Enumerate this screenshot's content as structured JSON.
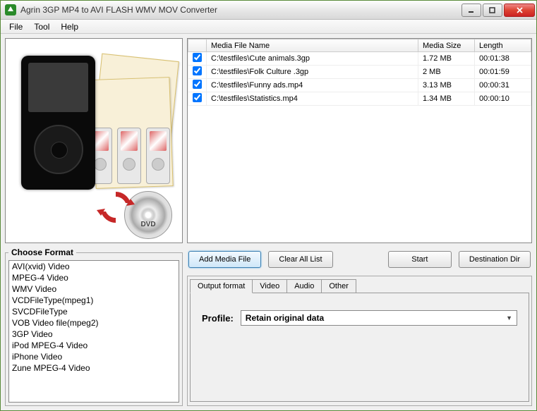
{
  "window": {
    "title": "Agrin 3GP MP4 to AVI FLASH WMV MOV Converter"
  },
  "menu": {
    "file": "File",
    "tool": "Tool",
    "help": "Help"
  },
  "table": {
    "col_name": "Media File Name",
    "col_size": "Media Size",
    "col_length": "Length",
    "rows": [
      {
        "name": "C:\\testfiles\\Cute animals.3gp",
        "size": "1.72 MB",
        "length": "00:01:38"
      },
      {
        "name": "C:\\testfiles\\Folk Culture .3gp",
        "size": "2 MB",
        "length": "00:01:59"
      },
      {
        "name": "C:\\testfiles\\Funny ads.mp4",
        "size": "3.13 MB",
        "length": "00:00:31"
      },
      {
        "name": "C:\\testfiles\\Statistics.mp4",
        "size": "1.34 MB",
        "length": "00:00:10"
      }
    ]
  },
  "buttons": {
    "add": "Add Media File",
    "clear": "Clear All List",
    "start": "Start",
    "dest": "Destination Dir"
  },
  "format": {
    "legend": "Choose Format",
    "items": [
      "AVI(xvid) Video",
      "MPEG-4 Video",
      "WMV Video",
      "VCDFileType(mpeg1)",
      "SVCDFileType",
      "VOB Video file(mpeg2)",
      "3GP Video",
      "iPod MPEG-4 Video",
      "iPhone Video",
      "Zune MPEG-4 Video"
    ]
  },
  "tabs": {
    "output": "Output format",
    "video": "Video",
    "audio": "Audio",
    "other": "Other"
  },
  "profile": {
    "label": "Profile:",
    "value": "Retain original data"
  },
  "dvd_label": "DVD"
}
